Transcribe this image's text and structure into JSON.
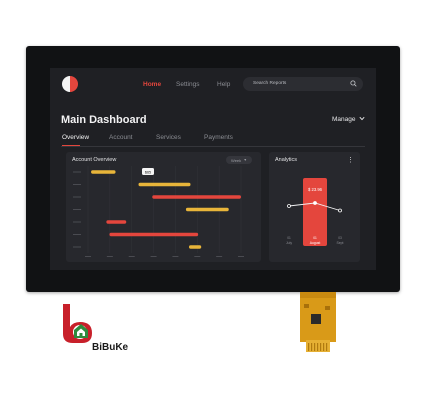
{
  "header": {
    "nav": [
      "Home",
      "Settings",
      "Help"
    ],
    "search_placeholder": "Search Reports"
  },
  "main": {
    "title": "Main Dashboard",
    "manage_label": "Manage",
    "tabs": [
      "Overview",
      "Account",
      "Services",
      "Payments"
    ]
  },
  "account_overview": {
    "title": "Account Overview",
    "filter_value": "Week",
    "callout": "$65",
    "bars": [
      {
        "color": "#e8b53a",
        "start": 0.02,
        "end": 0.18,
        "row": 0
      },
      {
        "color": "#e8b53a",
        "start": 0.33,
        "end": 0.67,
        "row": 1
      },
      {
        "color": "#e4463d",
        "start": 0.42,
        "end": 1.0,
        "row": 2
      },
      {
        "color": "#e8b53a",
        "start": 0.64,
        "end": 0.92,
        "row": 3
      },
      {
        "color": "#e4463d",
        "start": 0.12,
        "end": 0.25,
        "row": 4
      },
      {
        "color": "#e4463d",
        "start": 0.14,
        "end": 0.72,
        "row": 5
      },
      {
        "color": "#e8b53a",
        "start": 0.66,
        "end": 0.74,
        "row": 6
      }
    ]
  },
  "analytics": {
    "title": "Analytics",
    "highlight_value": "$ 23.96",
    "months": [
      "July",
      "August",
      "Sept"
    ],
    "points": [
      0.52,
      0.58,
      0.43
    ]
  },
  "brand": {
    "name": "BiBuKe"
  },
  "colors": {
    "accent": "#e4463d",
    "amber": "#e8b53a",
    "screen_bg": "#1f2024",
    "card_bg": "#27282d"
  }
}
